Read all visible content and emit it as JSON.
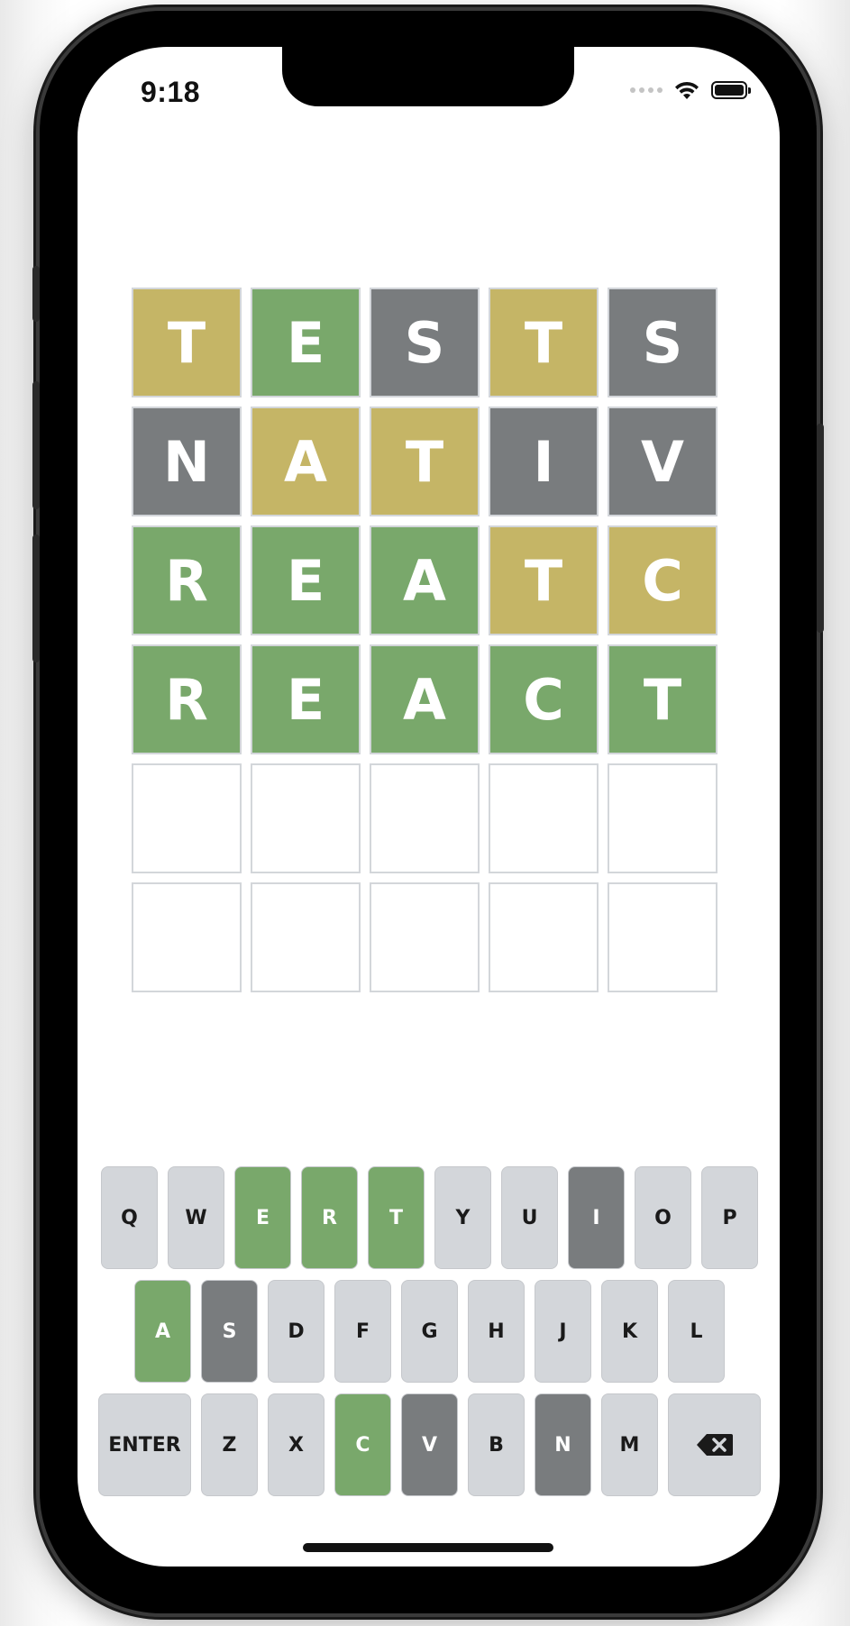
{
  "status_bar": {
    "time": "9:18",
    "icons": [
      "signal-dots-icon",
      "wifi-icon",
      "battery-icon"
    ]
  },
  "colors": {
    "correct": "#79a86b",
    "present": "#c5b566",
    "absent": "#797c7e",
    "key_default": "#d3d6da"
  },
  "board": {
    "rows": [
      [
        {
          "letter": "T",
          "state": "present"
        },
        {
          "letter": "E",
          "state": "correct"
        },
        {
          "letter": "S",
          "state": "absent"
        },
        {
          "letter": "T",
          "state": "present"
        },
        {
          "letter": "S",
          "state": "absent"
        }
      ],
      [
        {
          "letter": "N",
          "state": "absent"
        },
        {
          "letter": "A",
          "state": "present"
        },
        {
          "letter": "T",
          "state": "present"
        },
        {
          "letter": "I",
          "state": "absent"
        },
        {
          "letter": "V",
          "state": "absent"
        }
      ],
      [
        {
          "letter": "R",
          "state": "correct"
        },
        {
          "letter": "E",
          "state": "correct"
        },
        {
          "letter": "A",
          "state": "correct"
        },
        {
          "letter": "T",
          "state": "present"
        },
        {
          "letter": "C",
          "state": "present"
        }
      ],
      [
        {
          "letter": "R",
          "state": "correct"
        },
        {
          "letter": "E",
          "state": "correct"
        },
        {
          "letter": "A",
          "state": "correct"
        },
        {
          "letter": "C",
          "state": "correct"
        },
        {
          "letter": "T",
          "state": "correct"
        }
      ],
      [
        {
          "letter": "",
          "state": "empty"
        },
        {
          "letter": "",
          "state": "empty"
        },
        {
          "letter": "",
          "state": "empty"
        },
        {
          "letter": "",
          "state": "empty"
        },
        {
          "letter": "",
          "state": "empty"
        }
      ],
      [
        {
          "letter": "",
          "state": "empty"
        },
        {
          "letter": "",
          "state": "empty"
        },
        {
          "letter": "",
          "state": "empty"
        },
        {
          "letter": "",
          "state": "empty"
        },
        {
          "letter": "",
          "state": "empty"
        }
      ]
    ]
  },
  "keyboard": {
    "rows": [
      [
        {
          "label": "Q",
          "state": "default"
        },
        {
          "label": "W",
          "state": "default"
        },
        {
          "label": "E",
          "state": "correct"
        },
        {
          "label": "R",
          "state": "correct"
        },
        {
          "label": "T",
          "state": "correct"
        },
        {
          "label": "Y",
          "state": "default"
        },
        {
          "label": "U",
          "state": "default"
        },
        {
          "label": "I",
          "state": "absent"
        },
        {
          "label": "O",
          "state": "default"
        },
        {
          "label": "P",
          "state": "default"
        }
      ],
      [
        {
          "label": "A",
          "state": "correct"
        },
        {
          "label": "S",
          "state": "absent"
        },
        {
          "label": "D",
          "state": "default"
        },
        {
          "label": "F",
          "state": "default"
        },
        {
          "label": "G",
          "state": "default"
        },
        {
          "label": "H",
          "state": "default"
        },
        {
          "label": "J",
          "state": "default"
        },
        {
          "label": "K",
          "state": "default"
        },
        {
          "label": "L",
          "state": "default"
        }
      ],
      [
        {
          "label": "ENTER",
          "state": "default",
          "wide": true
        },
        {
          "label": "Z",
          "state": "default"
        },
        {
          "label": "X",
          "state": "default"
        },
        {
          "label": "C",
          "state": "correct"
        },
        {
          "label": "V",
          "state": "absent"
        },
        {
          "label": "B",
          "state": "default"
        },
        {
          "label": "N",
          "state": "absent"
        },
        {
          "label": "M",
          "state": "default"
        },
        {
          "label": "",
          "state": "default",
          "wide": true,
          "icon": "backspace-icon"
        }
      ]
    ]
  }
}
